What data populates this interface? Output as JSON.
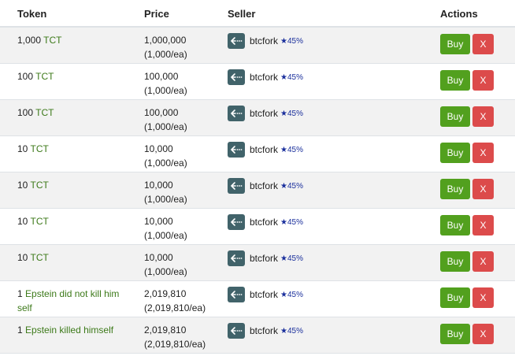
{
  "header": {
    "token": "Token",
    "price": "Price",
    "seller": "Seller",
    "actions": "Actions"
  },
  "rows": [
    {
      "qty": "1,000",
      "token": "TCT",
      "price": "1,000,000",
      "unit_price": "(1,000/ea)",
      "seller": "btcfork",
      "rating": "★45%",
      "buy": "Buy",
      "cancel": "X"
    },
    {
      "qty": "100",
      "token": "TCT",
      "price": "100,000",
      "unit_price": "(1,000/ea)",
      "seller": "btcfork",
      "rating": "★45%",
      "buy": "Buy",
      "cancel": "X"
    },
    {
      "qty": "100",
      "token": "TCT",
      "price": "100,000",
      "unit_price": "(1,000/ea)",
      "seller": "btcfork",
      "rating": "★45%",
      "buy": "Buy",
      "cancel": "X"
    },
    {
      "qty": "10",
      "token": "TCT",
      "price": "10,000",
      "unit_price": "(1,000/ea)",
      "seller": "btcfork",
      "rating": "★45%",
      "buy": "Buy",
      "cancel": "X"
    },
    {
      "qty": "10",
      "token": "TCT",
      "price": "10,000",
      "unit_price": "(1,000/ea)",
      "seller": "btcfork",
      "rating": "★45%",
      "buy": "Buy",
      "cancel": "X"
    },
    {
      "qty": "10",
      "token": "TCT",
      "price": "10,000",
      "unit_price": "(1,000/ea)",
      "seller": "btcfork",
      "rating": "★45%",
      "buy": "Buy",
      "cancel": "X"
    },
    {
      "qty": "10",
      "token": "TCT",
      "price": "10,000",
      "unit_price": "(1,000/ea)",
      "seller": "btcfork",
      "rating": "★45%",
      "buy": "Buy",
      "cancel": "X"
    },
    {
      "qty": "1",
      "token": "Epstein did not kill him self",
      "price": "2,019,810",
      "unit_price": "(2,019,810/ea)",
      "seller": "btcfork",
      "rating": "★45%",
      "buy": "Buy",
      "cancel": "X"
    },
    {
      "qty": "1",
      "token": "Epstein killed himself",
      "price": "2,019,810",
      "unit_price": "(2,019,810/ea)",
      "seller": "btcfork",
      "rating": "★45%",
      "buy": "Buy",
      "cancel": "X"
    }
  ],
  "colors": {
    "buy": "#52a01e",
    "cancel": "#dc4b4b",
    "token_link": "#3d7a1a",
    "rating": "#1a2f9c",
    "avatar": "#41636a"
  },
  "icons": {
    "seller_avatar": "fork-arrow-icon"
  }
}
